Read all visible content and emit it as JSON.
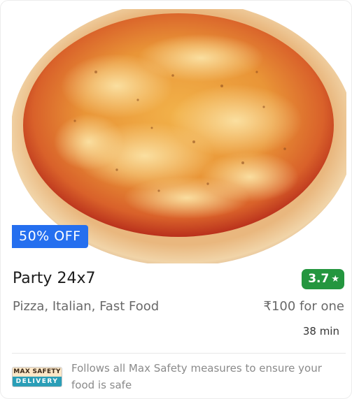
{
  "restaurant": {
    "name": "Party 24x7",
    "rating": "3.7",
    "cuisines": "Pizza, Italian, Fast Food",
    "price": "₹100 for one",
    "delivery_time": "38 min",
    "offer": "50% OFF",
    "image_icon": "pizza-photo"
  },
  "safety": {
    "logo_top": "MAX SAFETY",
    "logo_bottom": "DELIVERY",
    "text": "Follows all Max Safety measures to ensure your food is safe"
  },
  "colors": {
    "rating_green": "#24963f",
    "offer_blue": "#256fef",
    "safety_teal": "#2a9eb7"
  }
}
